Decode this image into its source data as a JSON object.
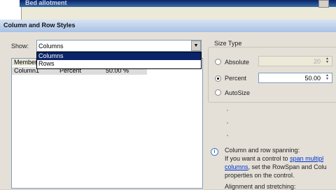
{
  "background_window": {
    "title": "Bed allotment"
  },
  "dialog": {
    "title": "Column and Row Styles",
    "show": {
      "label": "Show:",
      "value": "Columns",
      "options": [
        "Columns",
        "Rows"
      ]
    },
    "grid": {
      "header": "Member",
      "rows": [
        {
          "member": "Column1",
          "type": "Percent",
          "value": "50.00 %"
        }
      ]
    },
    "size_type": {
      "label": "Size Type",
      "absolute": {
        "label": "Absolute",
        "value": "20"
      },
      "percent": {
        "label": "Percent",
        "value": "50.00"
      },
      "autosize": {
        "label": "AutoSize"
      }
    },
    "info": {
      "line1": "Column and row spanning:",
      "line2_prefix": "If you want a control to",
      "line2_link": "span multipl",
      "line3_link": "columns",
      "line3_text": ", set the RowSpan and Colu",
      "line4": "properties on the control.",
      "line5": "Alignment and stretching:"
    }
  }
}
